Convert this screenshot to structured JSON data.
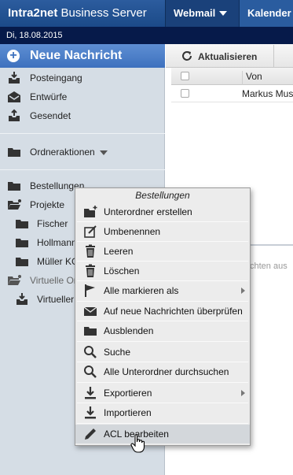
{
  "header": {
    "brand_name": "Intra2net",
    "brand_product": " Business Server",
    "nav": [
      {
        "label": "Webmail"
      },
      {
        "label": "Kalender"
      }
    ]
  },
  "date": "Di, 18.08.2015",
  "sidebar": {
    "new_message": "Neue Nachricht",
    "mailboxes": [
      {
        "label": "Posteingang",
        "icon": "inbox-icon"
      },
      {
        "label": "Entwürfe",
        "icon": "drafts-icon"
      },
      {
        "label": "Gesendet",
        "icon": "sent-icon"
      }
    ],
    "folder_actions": "Ordneraktionen",
    "folders": [
      {
        "label": "Bestellungen"
      },
      {
        "label": "Projekte"
      },
      {
        "label": "Fischer"
      },
      {
        "label": "Hollmann"
      },
      {
        "label": "Müller KG"
      },
      {
        "label": "Virtuelle Ordner"
      },
      {
        "label": "Virtueller"
      }
    ]
  },
  "toolbar": {
    "refresh_label": "Aktualisieren"
  },
  "message_list": {
    "columns": [
      "Von"
    ],
    "rows": [
      {
        "from": "Markus Mus"
      }
    ],
    "preview_hint": "chten aus"
  },
  "context_menu": {
    "title": "Bestellungen",
    "items": [
      {
        "label": "Unterordner erstellen",
        "icon": "folder-plus-icon"
      },
      {
        "label": "Umbenennen",
        "icon": "edit-icon"
      },
      {
        "label": "Leeren",
        "icon": "trash-icon"
      },
      {
        "label": "Löschen",
        "icon": "trash-icon"
      },
      {
        "label": "Alle markieren als",
        "icon": "flag-icon",
        "submenu": true
      },
      {
        "label": "Auf neue Nachrichten überprüfen",
        "icon": "envelope-icon"
      },
      {
        "label": "Ausblenden",
        "icon": "folder-icon"
      },
      {
        "label": "Suche",
        "icon": "search-icon"
      },
      {
        "label": "Alle Unterordner durchsuchen",
        "icon": "search-icon"
      },
      {
        "label": "Exportieren",
        "icon": "download-icon",
        "submenu": true
      },
      {
        "label": "Importieren",
        "icon": "download-icon"
      },
      {
        "label": "ACL bearbeiten",
        "icon": "pencil-icon",
        "hover": true
      }
    ]
  }
}
